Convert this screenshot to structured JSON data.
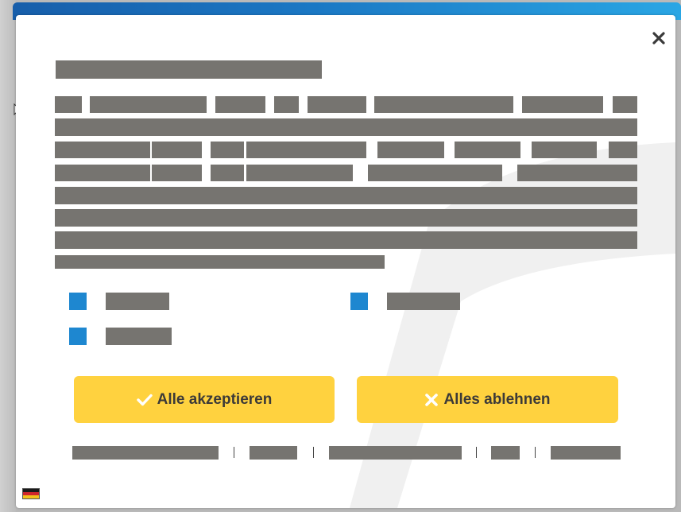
{
  "colors": {
    "accent_button": "#ffd23f",
    "checkbox": "#1e87d0",
    "redaction": "#767470",
    "header_gradient_start": "#175eaa",
    "header_gradient_end": "#2aa6e4"
  },
  "dialog": {
    "close_icon": "close-icon",
    "buttons": {
      "accept_all": {
        "icon": "checkmark-icon",
        "label": "Alle akzeptieren"
      },
      "reject_all": {
        "icon": "cross-icon",
        "label": "Alles ablehnen"
      }
    },
    "checkbox_count": 3,
    "footer_link_count": 5,
    "language_icon": "german-flag-icon"
  }
}
